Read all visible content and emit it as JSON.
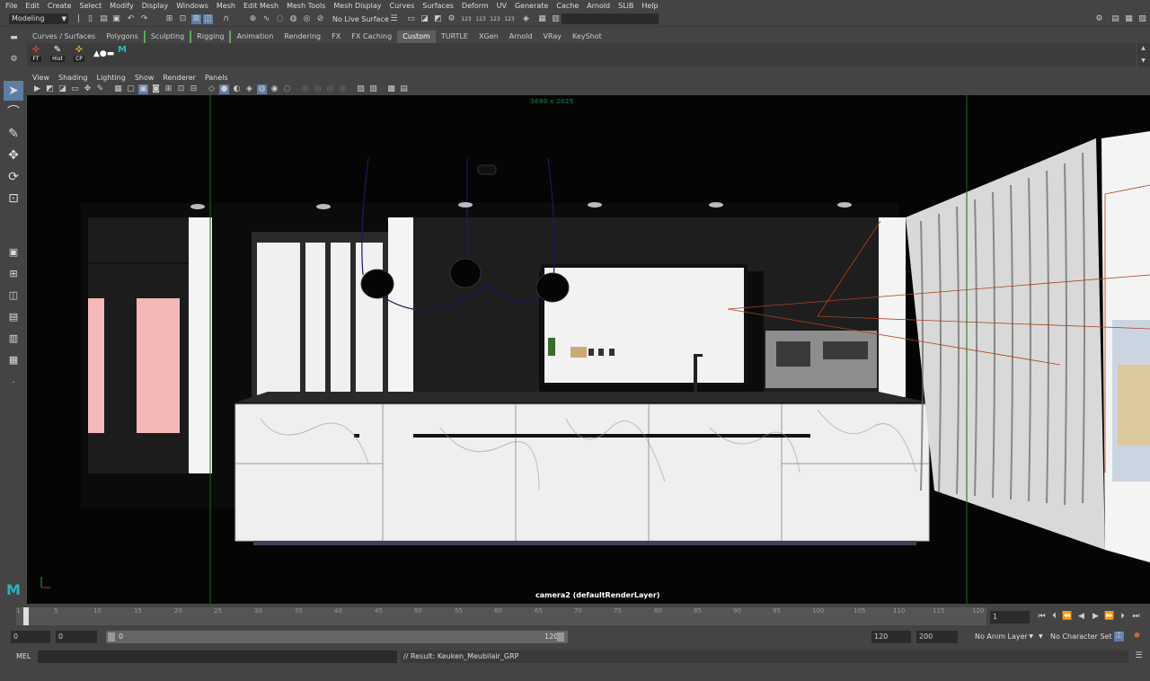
{
  "menu": [
    "File",
    "Edit",
    "Create",
    "Select",
    "Modify",
    "Display",
    "Windows",
    "Mesh",
    "Edit Mesh",
    "Mesh Tools",
    "Mesh Display",
    "Curves",
    "Surfaces",
    "Deform",
    "UV",
    "Generate",
    "Cache",
    "Arnold",
    "SLiB",
    "Help"
  ],
  "status_line": {
    "mode": "Modeling",
    "live_surface": "No Live Surface"
  },
  "shelf_tabs": [
    "Curves / Surfaces",
    "Polygons",
    "Sculpting",
    "Rigging",
    "Animation",
    "Rendering",
    "FX",
    "FX Caching",
    "Custom",
    "TURTLE",
    "XGen",
    "Arnold",
    "VRay",
    "KeyShot"
  ],
  "shelf_active": "Custom",
  "shelf_items": [
    {
      "label": "FT",
      "icon": "ft-icon"
    },
    {
      "label": "Hist",
      "icon": "history-icon"
    },
    {
      "label": "CP",
      "icon": "center-pivot-icon"
    },
    {
      "label": "",
      "icon": "shapes-icon"
    },
    {
      "label": "",
      "icon": "maya-logo-icon"
    }
  ],
  "panel_menu": [
    "View",
    "Shading",
    "Lighting",
    "Show",
    "Renderer",
    "Panels"
  ],
  "viewport": {
    "resolution": "3680 x 2025",
    "camera_label": "camera2 (defaultRenderLayer)"
  },
  "timeline": {
    "ticks": [
      "1",
      "5",
      "10",
      "15",
      "20",
      "25",
      "30",
      "35",
      "40",
      "45",
      "50",
      "55",
      "60",
      "65",
      "70",
      "75",
      "80",
      "85",
      "90",
      "95",
      "100",
      "105",
      "110",
      "115",
      "120"
    ],
    "current_frame": "1"
  },
  "range": {
    "start": "0",
    "anim_start": "0",
    "slider_left": "0",
    "slider_right": "120",
    "end": "120",
    "anim_end": "200",
    "anim_layer": "No Anim Layer",
    "character_set": "No Character Set"
  },
  "command": {
    "lang": "MEL",
    "result": "// Result: Keuken_Meubilair_GRP"
  },
  "colors": {
    "accent": "#5c7ea6",
    "viewport_bg": "#000000",
    "ui_bg": "#444444"
  }
}
